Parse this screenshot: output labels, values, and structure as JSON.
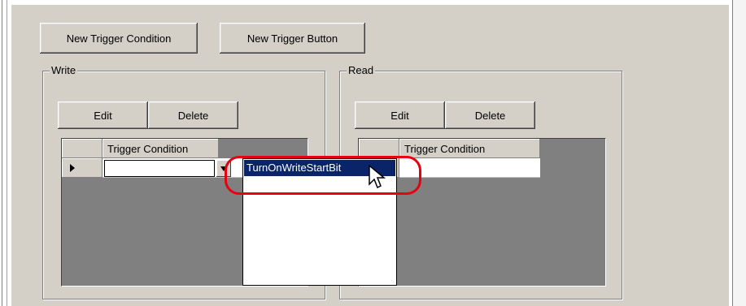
{
  "toolbar": {
    "new_trigger_condition": "New Trigger Condition",
    "new_trigger_button": "New Trigger Button"
  },
  "write_group": {
    "label": "Write",
    "edit": "Edit",
    "delete": "Delete",
    "column_header": "Trigger Condition"
  },
  "read_group": {
    "label": "Read",
    "edit": "Edit",
    "delete": "Delete",
    "column_header": "Trigger Condition"
  },
  "dropdown": {
    "options": [
      "TurnOnWriteStartBit"
    ],
    "selected": "TurnOnWriteStartBit"
  },
  "icons": {
    "row_indicator": "current-row-arrow-icon",
    "combo_arrow": "dropdown-arrow-icon",
    "cursor": "mouse-pointer-icon"
  },
  "colors": {
    "selection": "#0a246a",
    "highlight_callout": "#e60012",
    "window_face": "#d4d0c8"
  }
}
